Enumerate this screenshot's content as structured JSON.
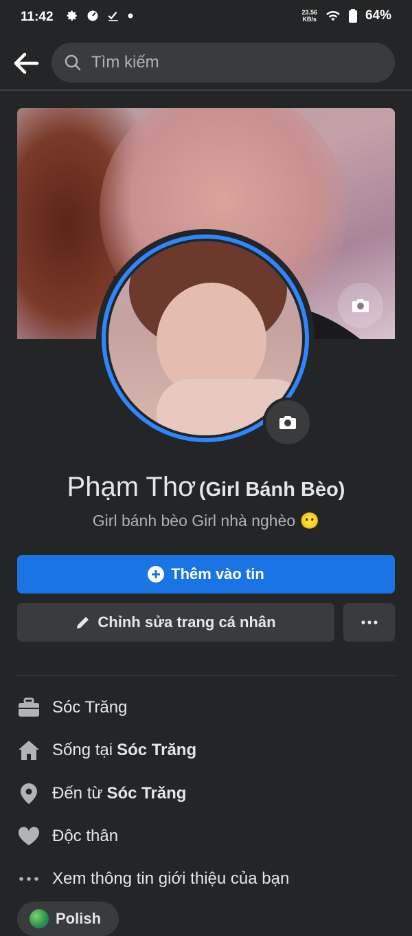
{
  "status_bar": {
    "time": "11:42",
    "speed_value": "23.56",
    "speed_unit": "KB/s",
    "battery": "64%"
  },
  "search": {
    "placeholder": "Tìm kiếm"
  },
  "profile": {
    "name": "Phạm Thơ",
    "alt_name": "(Girl Bánh Bèo)",
    "bio": "Girl bánh bèo Girl nhà nghèo 😶"
  },
  "actions": {
    "add_story": "Thêm vào tin",
    "edit_profile": "Chỉnh sửa trang cá nhân",
    "more": "···"
  },
  "intro": {
    "work": "Sóc Trăng",
    "lives_prefix": "Sống tại ",
    "lives_city": "Sóc Trăng",
    "from_prefix": "Đến từ ",
    "from_city": "Sóc Trăng",
    "relationship": "Độc thân",
    "see_about": "Xem thông tin giới thiệu của bạn"
  },
  "chip": {
    "label": "Polish"
  },
  "colors": {
    "accent": "#1b74e4",
    "ring": "#2d88ff",
    "bg": "#242526"
  }
}
